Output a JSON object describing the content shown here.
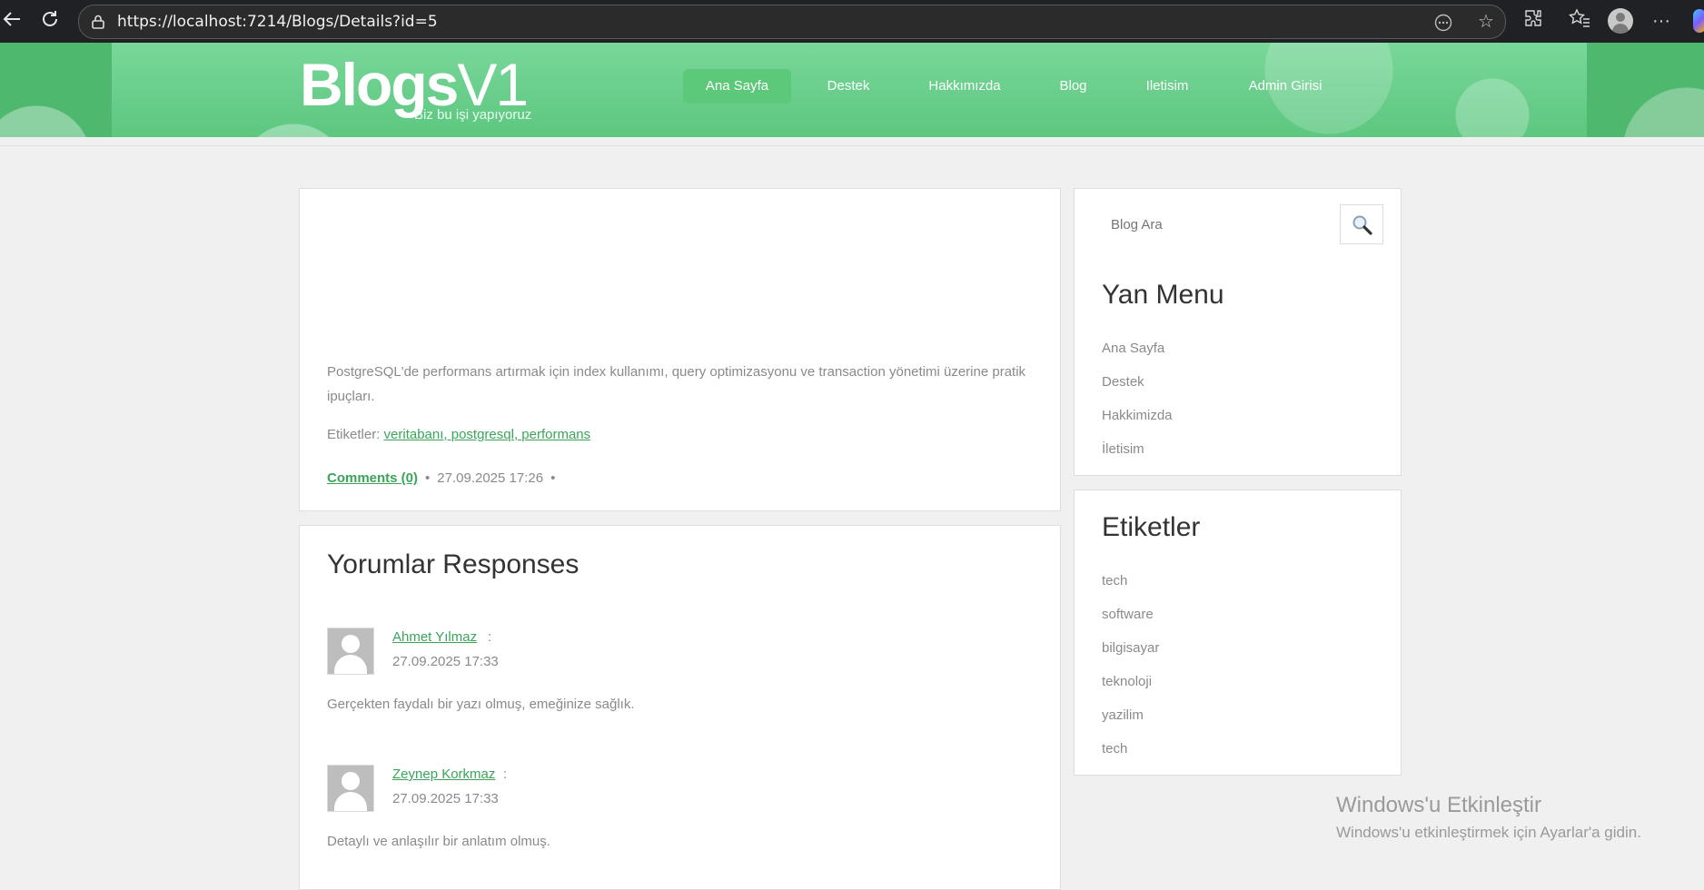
{
  "browser": {
    "url": "https://localhost:7214/Blogs/Details?id=5"
  },
  "site": {
    "logo_main": "Blogs",
    "logo_suffix": "V1",
    "tagline": "Biz bu işi yapıyoruz",
    "nav": [
      "Ana Sayfa",
      "Destek",
      "Hakkımızda",
      "Blog",
      "Iletisim",
      "Admin Girisi"
    ],
    "active_nav": "Ana Sayfa",
    "accent_color": "#3aa55a",
    "banner_color": "#6fd48d"
  },
  "post": {
    "description": "PostgreSQL'de performans artırmak için index kullanımı, query optimizasyonu ve transaction yönetimi üzerine pratik ipuçları.",
    "tags_label": "Etiketler:",
    "tags_value": "veritabanı, postgresql, performans",
    "comments_link": "Comments (0)",
    "date": "27.09.2025 17:26",
    "dot": "•"
  },
  "comments": {
    "title": "Yorumlar Responses",
    "items": [
      {
        "name": "Ahmet Yılmaz",
        "date": "27.09.2025 17:33",
        "text": "Gerçekten faydalı bir yazı olmuş, emeğinize sağlık."
      },
      {
        "name": "Zeynep Korkmaz",
        "date": "27.09.2025 17:33",
        "text": "Detaylı ve anlaşılır bir anlatım olmuş."
      }
    ]
  },
  "sidebar": {
    "search_placeholder": "Blog Ara",
    "menu_title": "Yan Menu",
    "menu_items": [
      "Ana Sayfa",
      "Destek",
      "Hakkimizda",
      "İletisim"
    ],
    "tags_title": "Etiketler",
    "tags": [
      "tech",
      "software",
      "bilgisayar",
      "teknoloji",
      "yazilim",
      "tech"
    ]
  },
  "watermark": {
    "line1": "Windows'u Etkinleştir",
    "line2": "Windows'u etkinleştirmek için Ayarlar'a gidin."
  }
}
